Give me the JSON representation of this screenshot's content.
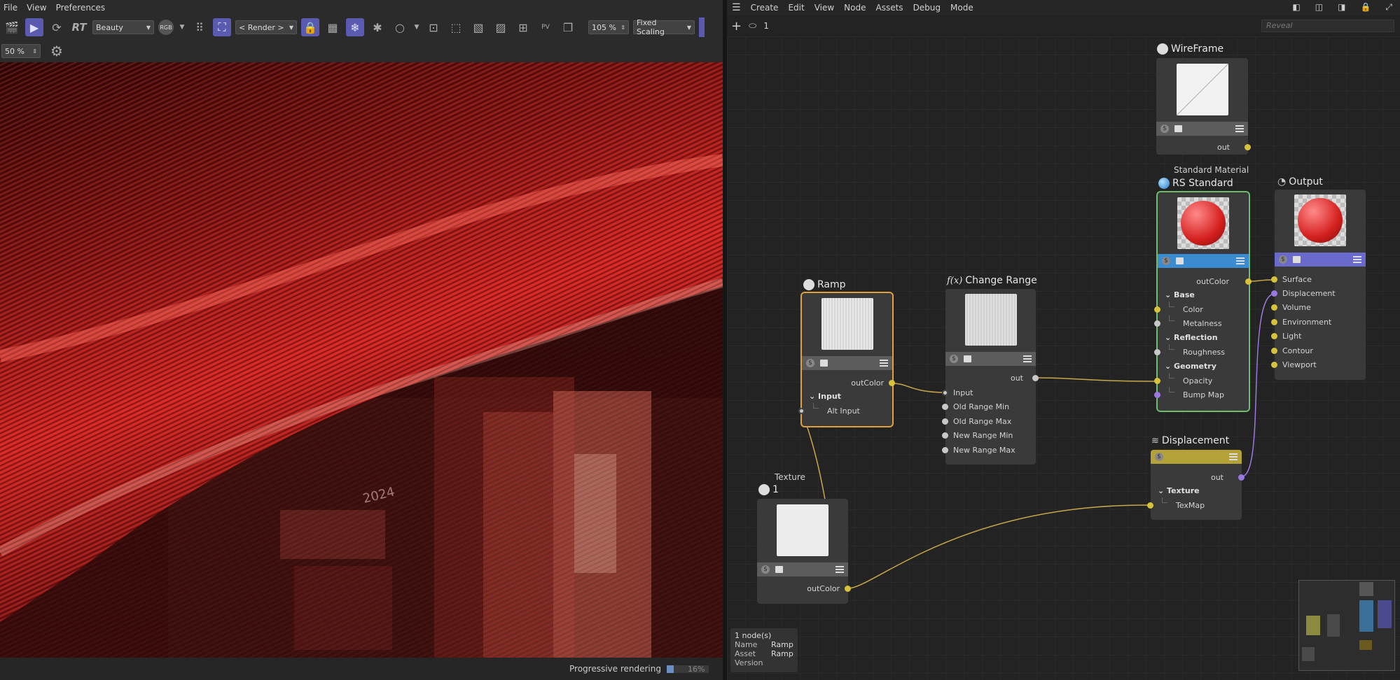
{
  "render_window": {
    "menu": [
      "File",
      "View",
      "Preferences"
    ],
    "toolbar": {
      "rt_label": "RT",
      "pass_select": "Beauty",
      "rgb_label": "RGB",
      "render_select": "< Render >",
      "zoom_value": "105 %",
      "scaling_select": "Fixed Scaling"
    },
    "view_zoom": "50 %",
    "status": {
      "label": "Progressive rendering",
      "progress_text": "16%",
      "progress": 0.16
    }
  },
  "node_editor": {
    "menu": [
      "Create",
      "Edit",
      "View",
      "Node",
      "Assets",
      "Debug",
      "Mode"
    ],
    "path_value": "1",
    "search_placeholder": "Reveal",
    "nodes": {
      "wireframe": {
        "title": "WireFrame",
        "out": "out"
      },
      "rs_standard": {
        "subtitle": "Standard Material",
        "title": "RS Standard",
        "out": "outColor",
        "groups": [
          {
            "label": "Base",
            "ports": [
              "Color",
              "Metalness"
            ]
          },
          {
            "label": "Reflection",
            "ports": [
              "Roughness"
            ]
          },
          {
            "label": "Geometry",
            "ports": [
              "Opacity",
              "Bump Map"
            ]
          }
        ]
      },
      "output": {
        "title": "Output",
        "ports": [
          "Surface",
          "Displacement",
          "Volume",
          "Environment",
          "Light",
          "Contour",
          "Viewport"
        ]
      },
      "ramp": {
        "title": "Ramp",
        "out": "outColor",
        "group": "Input",
        "port": "Alt Input"
      },
      "change_range": {
        "title": "Change Range",
        "fx": "f(x)",
        "out": "out",
        "ports": [
          "Input",
          "Old Range Min",
          "Old Range Max",
          "New Range Min",
          "New Range Max"
        ]
      },
      "texture": {
        "subtitle": "Texture",
        "title": "1",
        "out": "outColor"
      },
      "displacement": {
        "title": "Displacement",
        "out": "out",
        "group": "Texture",
        "port": "TexMap"
      }
    },
    "info": {
      "count": "1 node(s)",
      "rows": [
        {
          "key": "Name",
          "value": "Ramp"
        },
        {
          "key": "Asset",
          "value": "Ramp"
        },
        {
          "key": "Version",
          "value": ""
        }
      ]
    }
  },
  "colors": {
    "accent": "#5a5ab0",
    "wire_yellow": "#c9a84a",
    "wire_purple": "#9a78e0",
    "select_orange": "#e0a040",
    "select_green": "#6dbd6d",
    "rs_bar": "#3a8bd0",
    "output_bar": "#6a6acd",
    "displacement_bar": "#b4a238"
  }
}
